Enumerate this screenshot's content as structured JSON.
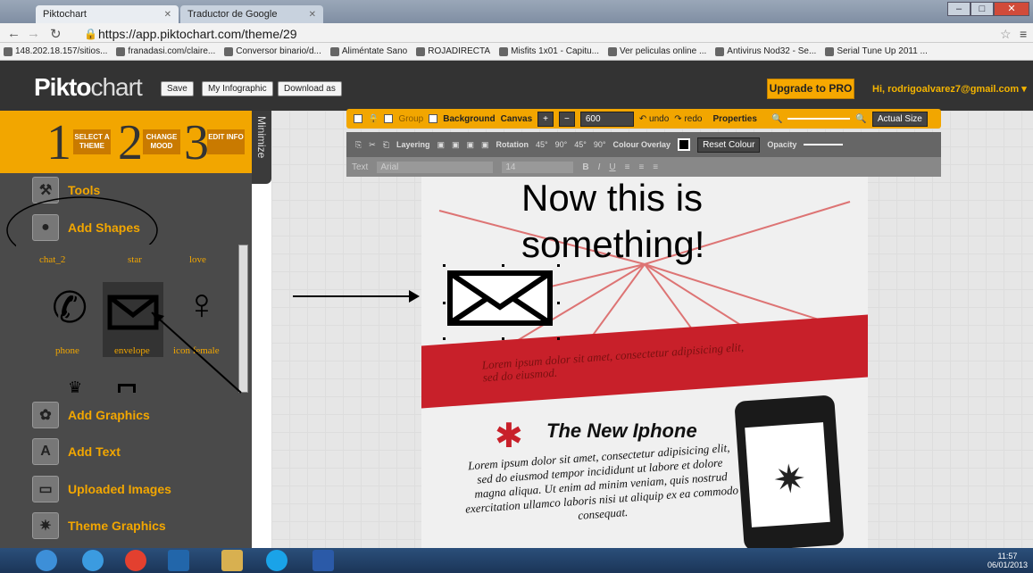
{
  "browser": {
    "tabs": [
      {
        "label": "Piktochart"
      },
      {
        "label": "Traductor de Google"
      }
    ],
    "url": "https://app.piktochart.com/theme/29",
    "bookmarks": [
      "148.202.18.157/sitios...",
      "franadasi.com/claire...",
      "Conversor binario/d...",
      "Aliméntate Sano",
      "ROJADIRECTA",
      "Misfits 1x01 - Capitu...",
      "Ver peliculas online ...",
      "Antivirus Nod32 - Se...",
      "Serial Tune Up 2011 ..."
    ]
  },
  "app": {
    "logo_bold": "Pikto",
    "logo_rest": "chart",
    "buttons": {
      "save": "Save",
      "my_infographic": "My Infographic",
      "download": "Download as"
    },
    "upgrade": "Upgrade to PRO",
    "user": "Hi, rodrigoalvarez7@gmail.com ▾"
  },
  "sidebar": {
    "steps": [
      {
        "num": "1",
        "label": "SELECT A THEME"
      },
      {
        "num": "2",
        "label": "CHANGE MOOD"
      },
      {
        "num": "3",
        "label": "EDIT INFO"
      }
    ],
    "minimize": "Minimize",
    "sections": {
      "tools": "Tools",
      "add_shapes": "Add Shapes",
      "add_graphics": "Add Graphics",
      "add_text": "Add Text",
      "uploaded_images": "Uploaded Images",
      "theme_graphics": "Theme Graphics"
    },
    "shape_labels_top": [
      "chat_2",
      "star",
      "love"
    ],
    "shape_labels_mid": [
      "phone",
      "envelope",
      "icon female"
    ]
  },
  "toolbar": {
    "group": "Group",
    "background": "Background",
    "canvas": "Canvas",
    "canvas_size": "600",
    "undo": "undo",
    "redo": "redo",
    "properties": "Properties",
    "actual_size": "Actual Size",
    "layering": "Layering",
    "rotation": "Rotation",
    "rot1": "45°",
    "rot2": "90°",
    "rot3": "45°",
    "rot4": "90°",
    "colour_overlay": "Colour Overlay",
    "reset_colour": "Reset Colour",
    "opacity": "Opacity",
    "text": "Text",
    "font": "Arial",
    "font_size": "14"
  },
  "infographic": {
    "headline_1": "Now this is",
    "headline_2": "something!",
    "red_text": "Lorem ipsum dolor sit amet, consectetur adipisicing elit, sed do eiusmod.",
    "title": "The New Iphone",
    "body": "Lorem ipsum dolor sit amet, consectetur adipisicing elit, sed do eiusmod tempor incididunt ut labore et dolore magna aliqua. Ut enim ad minim veniam, quis nostrud exercitation ullamco laboris nisi ut aliquip ex ea commodo consequat."
  },
  "taskbar": {
    "time": "11:57",
    "date": "06/01/2013"
  },
  "colors": {
    "accent": "#f2a600",
    "red": "#c8202a"
  }
}
